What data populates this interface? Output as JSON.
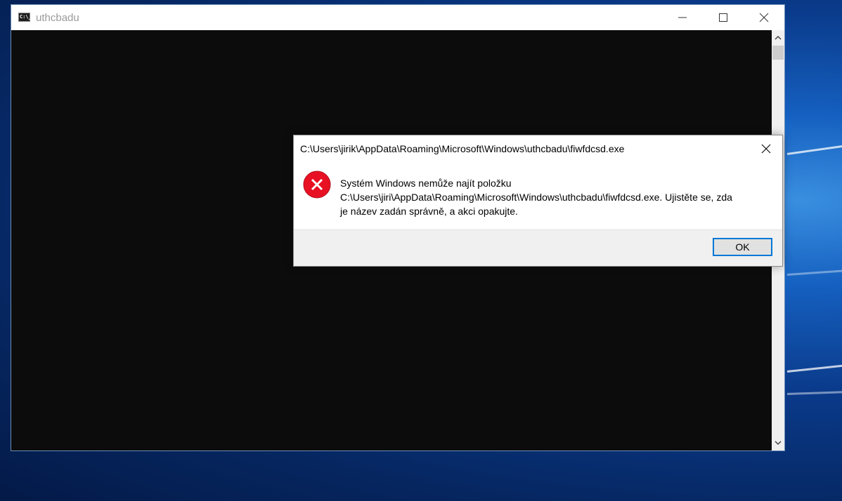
{
  "console": {
    "title": "uthcbadu",
    "icon": "console-icon",
    "icon_text": "C:\\_",
    "controls": [
      "minimize-icon",
      "maximize-icon",
      "close-icon"
    ]
  },
  "dialog": {
    "title": "C:\\Users\\jirik\\AppData\\Roaming\\Microsoft\\Windows\\uthcbadu\\fiwfdcsd.exe",
    "icon": "error-icon",
    "message_line1": "Systém Windows nemůže najít položku",
    "message_line2": "C:\\Users\\jiri\\AppData\\Roaming\\Microsoft\\Windows\\uthcbadu\\fiwfdcsd.exe. Ujistěte se, zda",
    "message_line3": "je název zadán správně, a akci opakujte.",
    "ok_label": "OK"
  },
  "colors": {
    "console_bg": "#0c0c0c",
    "error_red": "#e81123",
    "accent": "#0078d7"
  }
}
